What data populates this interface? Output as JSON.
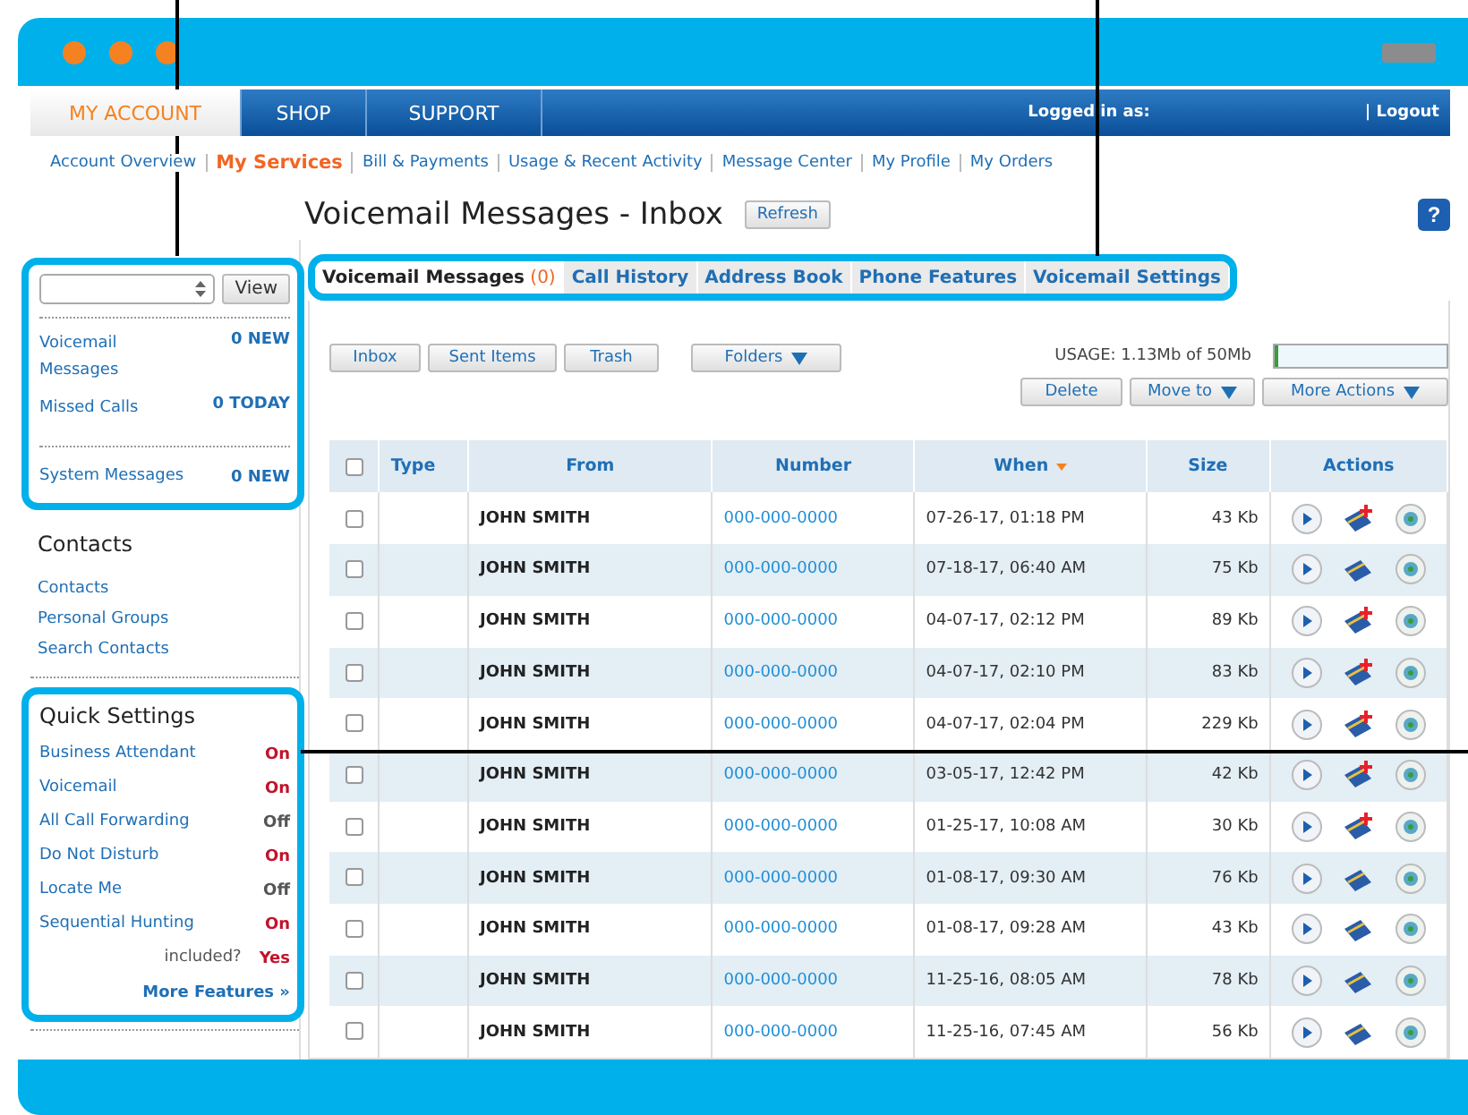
{
  "top_nav": {
    "tabs": [
      {
        "label": "MY ACCOUNT",
        "selected": true
      },
      {
        "label": "SHOP",
        "selected": false
      },
      {
        "label": "SUPPORT",
        "selected": false
      }
    ],
    "logged_in": "Logged in as:",
    "logout": "| Logout"
  },
  "sub_nav": [
    {
      "label": "Account Overview",
      "selected": false
    },
    {
      "label": "My Services",
      "selected": true
    },
    {
      "label": "Bill & Payments",
      "selected": false
    },
    {
      "label": "Usage & Recent Activity",
      "selected": false
    },
    {
      "label": "Message Center",
      "selected": false
    },
    {
      "label": "My Profile",
      "selected": false
    },
    {
      "label": "My Orders",
      "selected": false
    }
  ],
  "page_title": "Voicemail Messages - Inbox",
  "refresh": "Refresh",
  "help": "?",
  "sidebar": {
    "view_button": "View",
    "summary": [
      {
        "label": "Voicemail Messages",
        "value": "0 NEW"
      },
      {
        "label": "Missed Calls",
        "value": "0 TODAY"
      }
    ],
    "system": {
      "label": "System Messages",
      "value": "0 NEW"
    },
    "contacts_title": "Contacts",
    "contacts": [
      "Contacts",
      "Personal Groups",
      "Search Contacts"
    ],
    "quick_settings_title": "Quick Settings",
    "quick_settings": [
      {
        "label": "Business Attendant",
        "value": "On",
        "on": true
      },
      {
        "label": "Voicemail",
        "value": "On",
        "on": true
      },
      {
        "label": "All Call Forwarding",
        "value": "Off",
        "on": false
      },
      {
        "label": "Do Not Disturb",
        "value": "On",
        "on": true
      },
      {
        "label": "Locate Me",
        "value": "Off",
        "on": false
      },
      {
        "label": "Sequential Hunting",
        "value": "On",
        "on": true
      },
      {
        "label": "included?",
        "value": "Yes",
        "on": true
      }
    ],
    "more_features": "More Features »"
  },
  "tabs": [
    {
      "label": "Voicemail Messages",
      "count": "(0)",
      "selected": true
    },
    {
      "label": "Call History",
      "selected": false
    },
    {
      "label": "Address Book",
      "selected": false
    },
    {
      "label": "Phone Features",
      "selected": false
    },
    {
      "label": "Voicemail Settings",
      "selected": false
    }
  ],
  "folder_buttons": [
    "Inbox",
    "Sent Items",
    "Trash"
  ],
  "folders": "Folders",
  "usage": {
    "text": "USAGE: 1.13Mb of 50Mb",
    "level": 0.023
  },
  "actions": [
    "Delete",
    "Move to",
    "More Actions"
  ],
  "table": {
    "select_all": false,
    "columns": [
      "Type",
      "From",
      "Number",
      "When",
      "Size",
      "Actions"
    ],
    "rows": [
      {
        "from": "JOHN SMITH",
        "number": "000-000-0000",
        "when": "07-26-17, 01:18 PM",
        "size": "43 Kb",
        "add_contact": true,
        "checked": false
      },
      {
        "from": "JOHN SMITH",
        "number": "000-000-0000",
        "when": "07-18-17, 06:40 AM",
        "size": "75 Kb",
        "add_contact": false,
        "checked": false
      },
      {
        "from": "JOHN SMITH",
        "number": "000-000-0000",
        "when": "04-07-17, 02:12 PM",
        "size": "89 Kb",
        "add_contact": true,
        "checked": false
      },
      {
        "from": "JOHN SMITH",
        "number": "000-000-0000",
        "when": "04-07-17, 02:10 PM",
        "size": "83 Kb",
        "add_contact": true,
        "checked": false
      },
      {
        "from": "JOHN SMITH",
        "number": "000-000-0000",
        "when": "04-07-17, 02:04 PM",
        "size": "229 Kb",
        "add_contact": true,
        "checked": false
      },
      {
        "from": "JOHN SMITH",
        "number": "000-000-0000",
        "when": "03-05-17, 12:42 PM",
        "size": "42 Kb",
        "add_contact": true,
        "checked": false
      },
      {
        "from": "JOHN SMITH",
        "number": "000-000-0000",
        "when": "01-25-17, 10:08 AM",
        "size": "30 Kb",
        "add_contact": true,
        "checked": false
      },
      {
        "from": "JOHN SMITH",
        "number": "000-000-0000",
        "when": "01-08-17, 09:30 AM",
        "size": "76 Kb",
        "add_contact": false,
        "checked": false
      },
      {
        "from": "JOHN SMITH",
        "number": "000-000-0000",
        "when": "01-08-17, 09:28 AM",
        "size": "43 Kb",
        "add_contact": false,
        "checked": false
      },
      {
        "from": "JOHN SMITH",
        "number": "000-000-0000",
        "when": "11-25-16, 08:05 AM",
        "size": "78 Kb",
        "add_contact": false,
        "checked": false
      },
      {
        "from": "JOHN SMITH",
        "number": "000-000-0000",
        "when": "11-25-16, 07:45 AM",
        "size": "56 Kb",
        "add_contact": false,
        "checked": false
      }
    ]
  }
}
